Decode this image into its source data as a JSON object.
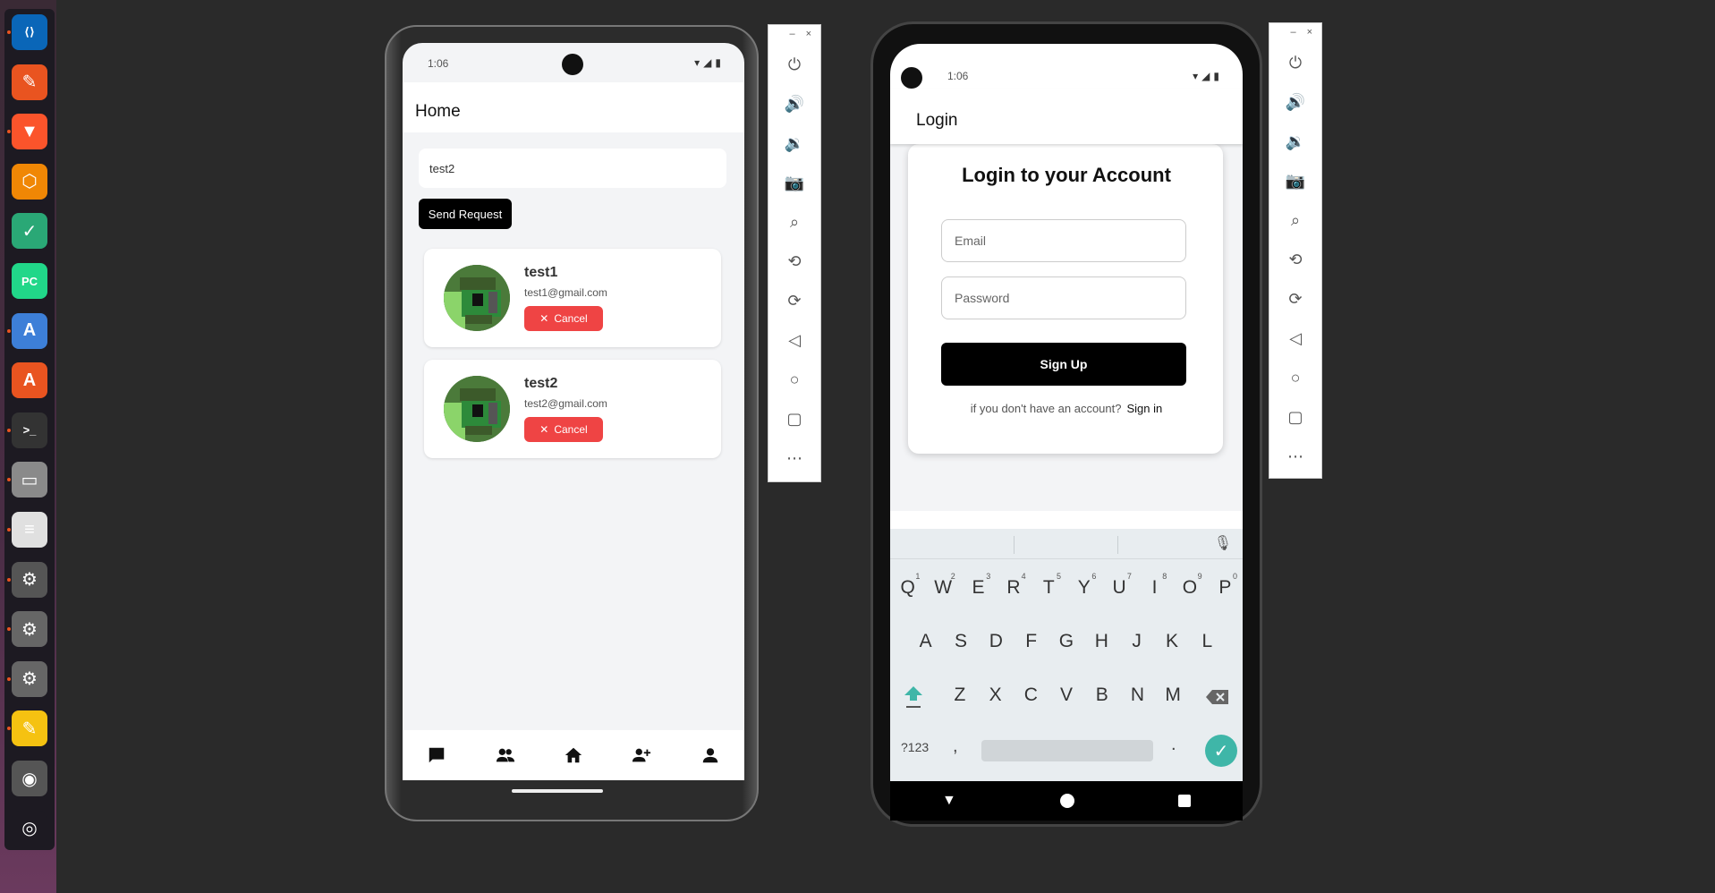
{
  "dock": {
    "apps": [
      {
        "name": "vscode-icon",
        "glyph": "⟨⟩",
        "bg": "#0a66b8",
        "running": true
      },
      {
        "name": "pen-app-icon",
        "glyph": "✎",
        "bg": "#e95420",
        "running": false
      },
      {
        "name": "brave-icon",
        "glyph": "▼",
        "bg": "#fb542b",
        "running": true
      },
      {
        "name": "drawio-icon",
        "glyph": "⬡",
        "bg": "#f08705",
        "running": false
      },
      {
        "name": "checklist-icon",
        "glyph": "✓",
        "bg": "#2aa876",
        "running": false
      },
      {
        "name": "pycharm-icon",
        "glyph": "PC",
        "bg": "#21d789",
        "running": false
      },
      {
        "name": "android-studio-icon",
        "glyph": "A",
        "bg": "#3d7fd8",
        "running": true
      },
      {
        "name": "app-center-icon",
        "glyph": "A",
        "bg": "#e95420",
        "running": false
      },
      {
        "name": "terminal-icon",
        "glyph": ">_",
        "bg": "#333333",
        "running": true
      },
      {
        "name": "files-icon",
        "glyph": "▭",
        "bg": "#8a8a8a",
        "running": true
      },
      {
        "name": "document-viewer-icon",
        "glyph": "≡",
        "bg": "#e0e0e0",
        "running": true
      },
      {
        "name": "settings-icon-1",
        "glyph": "⚙",
        "bg": "#555555",
        "running": true
      },
      {
        "name": "settings-icon-2",
        "glyph": "⚙",
        "bg": "#666666",
        "running": true
      },
      {
        "name": "settings-icon-3",
        "glyph": "⚙",
        "bg": "#666666",
        "running": true
      },
      {
        "name": "text-editor-icon",
        "glyph": "✎",
        "bg": "#f5c211",
        "running": true
      },
      {
        "name": "disk-icon",
        "glyph": "◉",
        "bg": "#555555",
        "running": false
      },
      {
        "name": "ubuntu-icon",
        "glyph": "◎",
        "bg": "#1d1a22",
        "running": false
      }
    ]
  },
  "phone1": {
    "status_time": "1:06",
    "appbar_title": "Home",
    "search_value": "test2",
    "send_label": "Send Request",
    "cards": [
      {
        "name": "test1",
        "email": "test1@gmail.com",
        "cancel_label": "Cancel"
      },
      {
        "name": "test2",
        "email": "test2@gmail.com",
        "cancel_label": "Cancel"
      }
    ]
  },
  "phone2": {
    "status_time": "1:06",
    "appbar_title": "Login",
    "heading": "Login to your Account",
    "email_placeholder": "Email",
    "password_placeholder": "Password",
    "signup_label": "Sign Up",
    "account_prompt": "if you don't have an account?",
    "signin_label": "Sign in",
    "keyboard": {
      "row1": [
        "Q",
        "W",
        "E",
        "R",
        "T",
        "Y",
        "U",
        "I",
        "O",
        "P"
      ],
      "row1_nums": [
        "1",
        "2",
        "3",
        "4",
        "5",
        "6",
        "7",
        "8",
        "9",
        "0"
      ],
      "row2": [
        "A",
        "S",
        "D",
        "F",
        "G",
        "H",
        "J",
        "K",
        "L"
      ],
      "row3": [
        "Z",
        "X",
        "C",
        "V",
        "B",
        "N",
        "M"
      ],
      "symbols_label": "?123",
      "comma": ",",
      "period": "."
    }
  },
  "colors": {
    "cancel": "#ef4444",
    "accent_teal": "#3fb6a8"
  }
}
